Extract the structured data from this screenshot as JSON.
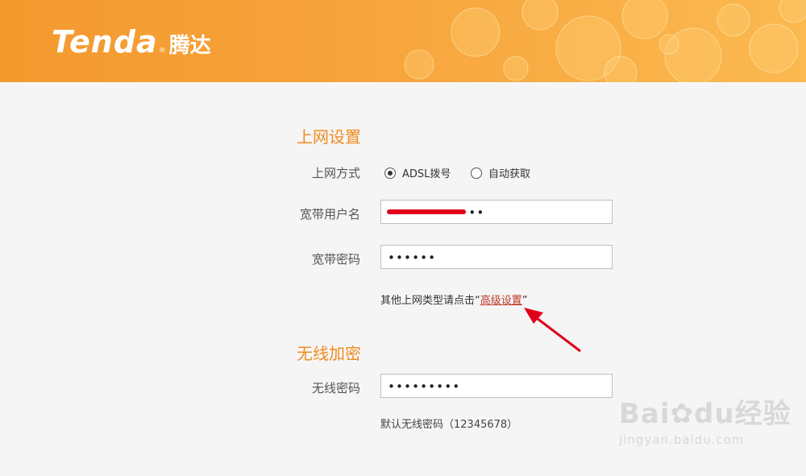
{
  "header": {
    "logo_en": "Tenda",
    "logo_reg": "®",
    "logo_cn": "腾达"
  },
  "internet": {
    "section_title": "上网设置",
    "mode_label": "上网方式",
    "mode_options": [
      "ADSL拨号",
      "自动获取"
    ],
    "mode_selected": "ADSL拨号",
    "username_label": "宽带用户名",
    "username_value": "••••••••••••",
    "password_label": "宽带密码",
    "password_value": "••••••",
    "hint_prefix": "其他上网类型请点击“",
    "hint_link": "高级设置",
    "hint_suffix": "”"
  },
  "wireless": {
    "section_title": "无线加密",
    "password_label": "无线密码",
    "password_value": "•••••••••",
    "default_note": "默认无线密码（12345678）"
  },
  "watermark": {
    "main": "Bai",
    "main2": "du",
    "cn": "经验",
    "sub": "jingyan.baidu.com"
  },
  "colors": {
    "brand_orange": "#f39a2e",
    "section_title": "#f08c1e",
    "link_red": "#c0392b",
    "annotation_red": "#e0001a"
  }
}
